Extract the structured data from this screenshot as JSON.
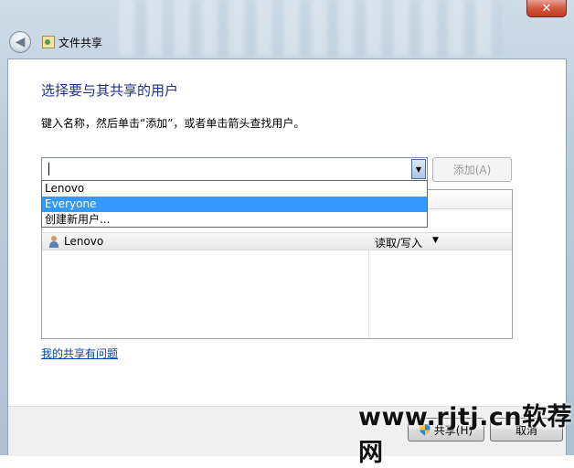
{
  "window": {
    "title": "文件共享",
    "close_glyph": "✕",
    "back_glyph": "◀"
  },
  "main": {
    "heading": "选择要与其共享的用户",
    "instruction": "键入名称，然后单击“添加”，或者单击箭头查找用户。",
    "input_value": "",
    "add_button": "添加(A)"
  },
  "dropdown": {
    "options": [
      "Lenovo",
      "Everyone",
      "创建新用户..."
    ],
    "selected_index": 1
  },
  "share_list": {
    "rows": [
      {
        "name": "Lenovo",
        "permission": "读取/写入",
        "permission_arrow": "▼"
      }
    ]
  },
  "links": {
    "problem": "我的共享有问题"
  },
  "footer": {
    "share_button": "共享(H)",
    "cancel_button": "取消"
  },
  "watermark": "www.rjtj.cn软荐网",
  "colors": {
    "heading": "#1e3287",
    "selection": "#3399ff",
    "link": "#0645ad"
  }
}
